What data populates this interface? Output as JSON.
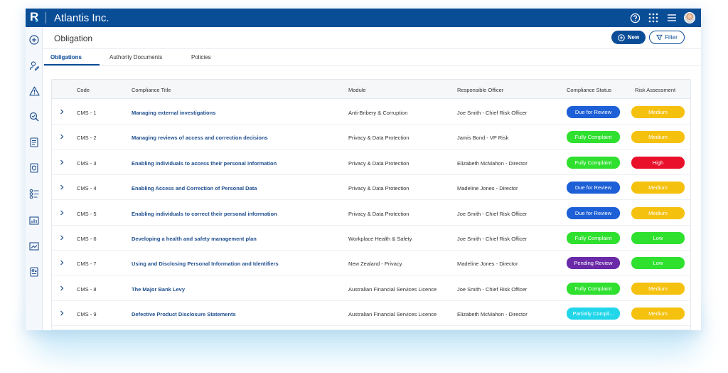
{
  "header": {
    "logo": "R",
    "company": "Atlantis Inc.",
    "icons": [
      "help-icon",
      "apps-grid-icon",
      "menu-icon",
      "user-avatar"
    ]
  },
  "sidebar": {
    "icons": [
      "add-circle-icon",
      "user-edit-icon",
      "warning-icon",
      "search-check-icon",
      "document-icon",
      "shield-document-icon",
      "checklist-icon",
      "report-chart-icon",
      "trend-chart-icon",
      "id-card-icon"
    ]
  },
  "page": {
    "title": "Obligation",
    "new_label": "New",
    "filter_label": "Filter"
  },
  "tabs": [
    {
      "label": "Obligations",
      "active": true
    },
    {
      "label": "Authority Documents",
      "active": false
    },
    {
      "label": "Policies",
      "active": false
    }
  ],
  "table": {
    "columns": [
      "Code",
      "Compliance Title",
      "Module",
      "Responsible Officer",
      "Compliance Status",
      "Risk Assessment"
    ],
    "rows": [
      {
        "code": "CMS - 1",
        "title": "Managing external investigations",
        "module": "Anti-Bribery & Corruption",
        "officer": "Joe Smith - Chief Risk Officer",
        "status": "Due for Review",
        "risk": "Medium"
      },
      {
        "code": "CMS - 2",
        "title": "Managing reviews of access and correction decisions",
        "module": "Privacy & Data Protection",
        "officer": "Jamis Bond - VP Risk",
        "status": "Fully Complaint",
        "risk": "Medium"
      },
      {
        "code": "CMS - 3",
        "title": "Enabling individuals to access their personal information",
        "module": "Privacy & Data Protection",
        "officer": "Elizabeth McMahon - Director",
        "status": "Fully Complaint",
        "risk": "High"
      },
      {
        "code": "CMS - 4",
        "title": "Enabling Access and Correction of Personal Data",
        "module": "Privacy & Data Protection",
        "officer": "Madeline Jones - Director",
        "status": "Due for Review",
        "risk": "Medium"
      },
      {
        "code": "CMS - 5",
        "title": "Enabling individuals to correct their personal information",
        "module": "Privacy & Data Protection",
        "officer": "Joe Smith - Chief Risk Officer",
        "status": "Due for Review",
        "risk": "Medium"
      },
      {
        "code": "CMS - 6",
        "title": "Developing a health and safety management plan",
        "module": "Workplace Health & Safety",
        "officer": "Joe Smith - Chief Risk Officer",
        "status": "Fully Complaint",
        "risk": "Low"
      },
      {
        "code": "CMS - 7",
        "title": "Using and Disclosing Personal Information and Identifiers",
        "module": "New Zealand - Privacy",
        "officer": "Madeline Jones - Director",
        "status": "Pending Review",
        "risk": "Low"
      },
      {
        "code": "CMS - 8",
        "title": "The Major Bank Levy",
        "module": "Australian Financial Services Licence",
        "officer": "Joe Smith - Chief Risk Officer",
        "status": "Fully Complaint",
        "risk": "Medium"
      },
      {
        "code": "CMS - 9",
        "title": "Defective Product Disclosure Statements",
        "module": "Australian Financial Services Licence",
        "officer": "Elizabeth McMahon - Director",
        "status": "Partially Compli...",
        "risk": "Medium"
      }
    ]
  },
  "colors": {
    "brand": "#0a4d97",
    "status": {
      "Due for Review": "#1d5fd6",
      "Fully Complaint": "#2fe02f",
      "Pending Review": "#6a2aa8",
      "Partially Compli...": "#22d6ea"
    },
    "risk": {
      "Medium": "#f5c10f",
      "High": "#e8102a",
      "Low": "#2fe02f"
    }
  }
}
